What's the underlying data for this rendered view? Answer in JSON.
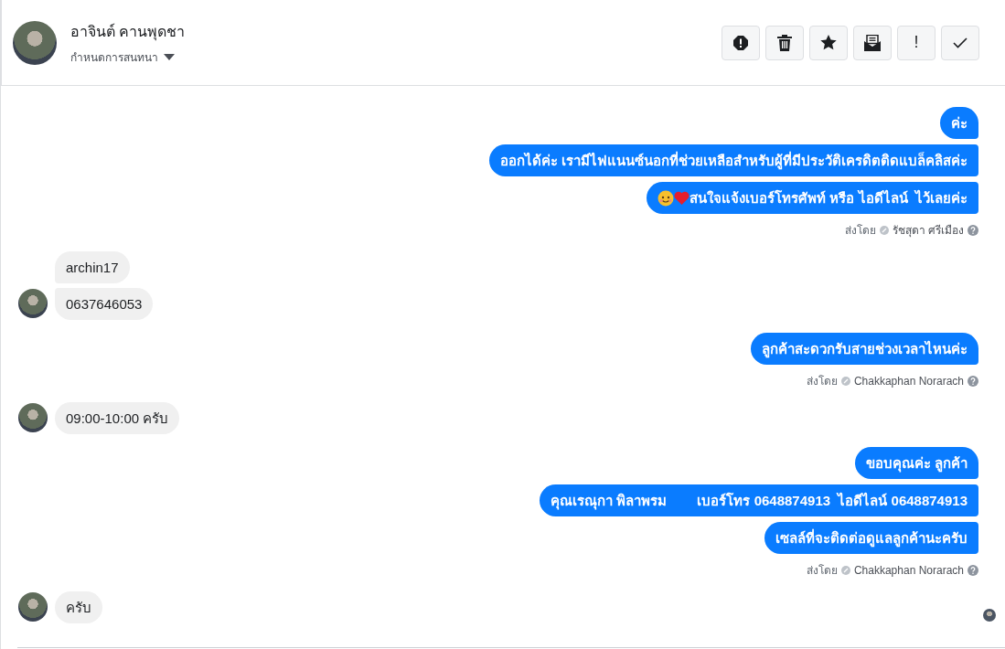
{
  "header": {
    "name": "อาจินต์ คานพุดชา",
    "conversation_menu": "กำหนดการสนทนา"
  },
  "toolbar": [
    {
      "kind": "spam"
    },
    {
      "kind": "delete"
    },
    {
      "kind": "star"
    },
    {
      "kind": "unread"
    },
    {
      "kind": "important",
      "label": "!"
    },
    {
      "kind": "done"
    }
  ],
  "messages": [
    {
      "kind": "outgoing",
      "bubbles": [
        {
          "text": "ค่ะ"
        },
        {
          "text": "ออกได้ค่ะ เรามีไฟแนนซ์นอกที่ช่วยเหลือสำหรับผู้ที่มีประวัติเครดิตติดแบล็คลิสค่ะ"
        },
        {
          "text": "สนใจแจ้งเบอร์โทรศัพท์ หรือ ไอดีไลน์  ไว้เลยค่ะ",
          "emoji_prefix": true
        }
      ],
      "sent_by": {
        "label": "ส่งโดย",
        "name": "รัชสุดา ศรีเมือง"
      }
    },
    {
      "kind": "incoming",
      "bubbles": [
        {
          "text": "archin17"
        },
        {
          "text": "0637646053"
        }
      ]
    },
    {
      "kind": "outgoing",
      "bubbles": [
        {
          "text": "ลูกค้าสะดวกรับสายช่วงเวลาไหนค่ะ"
        }
      ],
      "sent_by": {
        "label": "ส่งโดย",
        "name": "Chakkaphan Norarach"
      }
    },
    {
      "kind": "incoming",
      "bubbles": [
        {
          "text": "09:00-10:00 ครับ"
        }
      ]
    },
    {
      "kind": "outgoing",
      "bubbles": [
        {
          "text": "ขอบคุณค่ะ ลูกค้า"
        },
        {
          "text": "คุณเรณุกา พิลาพรม        เบอร์โทร 0648874913  ไอดีไลน์ 0648874913"
        },
        {
          "text": "เซลล์ที่จะติดต่อดูแลลูกค้านะครับ"
        }
      ],
      "sent_by": {
        "label": "ส่งโดย",
        "name": "Chakkaphan Norarach"
      }
    },
    {
      "kind": "incoming",
      "bubbles": [
        {
          "text": "ครับ"
        }
      ],
      "seen": true
    }
  ]
}
